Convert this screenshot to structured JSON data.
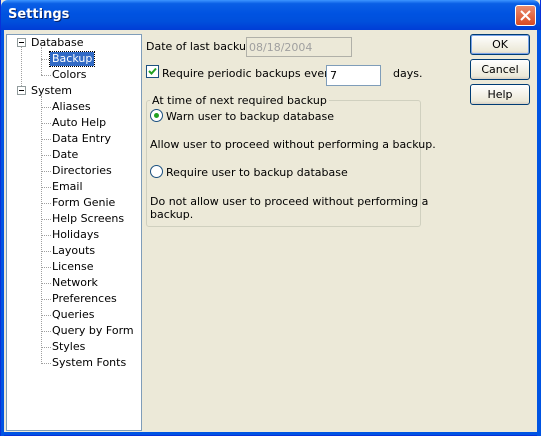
{
  "window": {
    "title": "Settings"
  },
  "tree": {
    "database": {
      "label": "Database",
      "children": [
        "Backup",
        "Colors"
      ]
    },
    "system": {
      "label": "System",
      "children": [
        "Aliases",
        "Auto Help",
        "Data Entry",
        "Date",
        "Directories",
        "Email",
        "Form Genie",
        "Help Screens",
        "Holidays",
        "Layouts",
        "License",
        "Network",
        "Preferences",
        "Queries",
        "Query by Form",
        "Styles",
        "System Fonts"
      ]
    },
    "selected": "Backup"
  },
  "backup": {
    "date_label": "Date of last backup:",
    "date_value": "08/18/2004",
    "periodic_label": "Require periodic backups every",
    "periodic_checked": true,
    "periodic_value": "7",
    "days_label": "days.",
    "group_title": "At time of next required backup",
    "warn_label": "Warn user to backup database",
    "warn_desc": "Allow user to proceed without performing a backup.",
    "require_label": "Require user to backup database",
    "require_desc_1": "Do not allow user to proceed without performing a",
    "require_desc_2": "backup.",
    "selected_option": "warn"
  },
  "buttons": {
    "ok": "OK",
    "cancel": "Cancel",
    "help": "Help"
  },
  "colors": {
    "title_bar": "#0053e1",
    "selection": "#316ac5",
    "close": "#d94a22"
  }
}
